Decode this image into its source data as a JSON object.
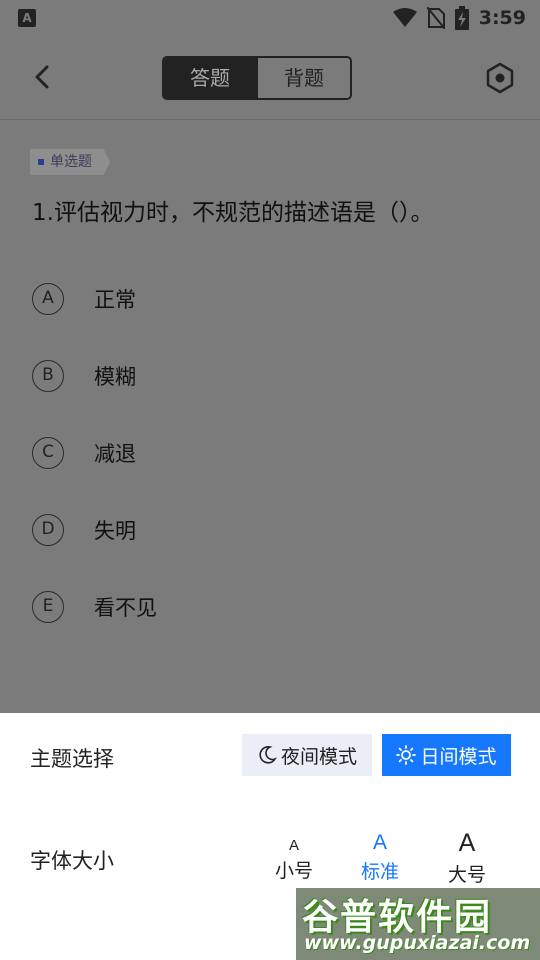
{
  "status_bar": {
    "time": "3:59",
    "notification_glyph": "A",
    "icons": [
      "wifi-icon",
      "no-sim-icon",
      "battery-charging-icon"
    ]
  },
  "header": {
    "back_icon": "chevron-left-icon",
    "tabs": [
      {
        "label": "答题",
        "active": true
      },
      {
        "label": "背题",
        "active": false
      }
    ],
    "settings_icon": "hexagon-settings-icon"
  },
  "question": {
    "type_badge": "单选题",
    "text": "1.评估视力时，不规范的描述语是（）。",
    "options": [
      {
        "letter": "A",
        "text": "正常"
      },
      {
        "letter": "B",
        "text": "模糊"
      },
      {
        "letter": "C",
        "text": "减退"
      },
      {
        "letter": "D",
        "text": "失明"
      },
      {
        "letter": "E",
        "text": "看不见"
      }
    ]
  },
  "settings_sheet": {
    "theme_label": "主题选择",
    "night_mode_label": "夜间模式",
    "day_mode_label": "日间模式",
    "selected_theme": "day",
    "font_size_label": "字体大小",
    "font_sizes": [
      {
        "glyph": "A",
        "label": "小号",
        "active": false
      },
      {
        "glyph": "A",
        "label": "标准",
        "active": true
      },
      {
        "glyph": "A",
        "label": "大号",
        "active": false
      }
    ],
    "accent_color": "#1677ff"
  },
  "watermark": {
    "title": "谷普软件园",
    "url": "www.gupuxiazai.com"
  }
}
